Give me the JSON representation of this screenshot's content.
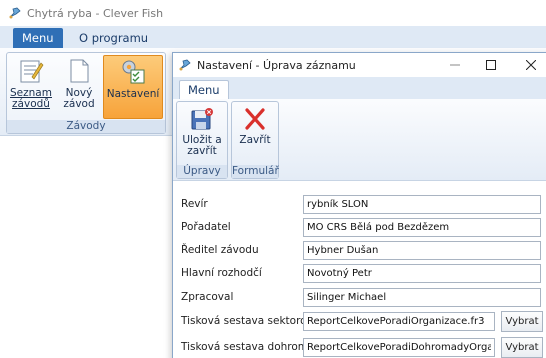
{
  "app": {
    "title": "Chytrá ryba - Clever Fish",
    "tabs": [
      {
        "label": "Menu"
      },
      {
        "label": "O programu"
      }
    ],
    "ribbon": {
      "group_label": "Závody",
      "buttons": [
        {
          "label": "Seznam závodů",
          "icon": "list-icon"
        },
        {
          "label": "Nový závod",
          "icon": "new-document-icon"
        },
        {
          "label": "Nastavení",
          "icon": "settings-icon"
        }
      ]
    }
  },
  "dialog": {
    "title": "Nastavení - Úprava záznamu",
    "tab": "Menu",
    "groups": [
      {
        "label": "Úpravy",
        "button": "Uložit a zavřít",
        "icon": "save-close-icon"
      },
      {
        "label": "Formulář",
        "button": "Zavřít",
        "icon": "close-x-icon"
      }
    ],
    "fields": [
      {
        "label": "Revír",
        "value": "rybník SLON"
      },
      {
        "label": "Pořadatel",
        "value": "MO ČRS Bělá pod Bezdězem"
      },
      {
        "label": "Ředitel závodu",
        "value": "Hybner Dušan"
      },
      {
        "label": "Hlavní rozhodčí",
        "value": "Novotný Petr"
      },
      {
        "label": "Zpracoval",
        "value": "Šilinger Michael"
      },
      {
        "label": "Tisková sestava sektorová",
        "value": "ReportCelkovePoradiOrganizace.fr3",
        "button": "Vybrat"
      },
      {
        "label": "Tisková sestava dohromady",
        "value": "ReportCelkovePoradiDohromadyOrganizace.",
        "button": "Vybrat"
      }
    ]
  },
  "colors": {
    "accent": "#2f6fb6",
    "active_button": "#f7a33a",
    "ribbon_bg": "#e4ecf6"
  }
}
